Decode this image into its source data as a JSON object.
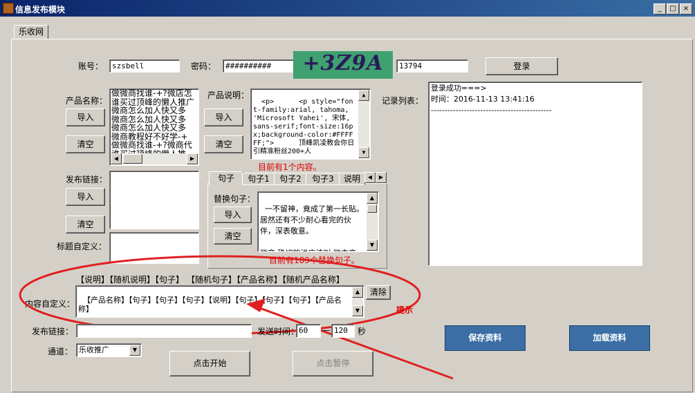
{
  "window": {
    "title": "信息发布模块",
    "minimize": "_",
    "maximize": "□",
    "close": "×"
  },
  "tab_main": "乐收网",
  "login": {
    "account_label": "账号：",
    "account_value": "szsbell",
    "password_label": "密码：",
    "password_value": "##########",
    "captcha_text": "+3Z9A",
    "captcha_input": "13794",
    "login_button": "登录"
  },
  "product_name": {
    "label": "产品名称：",
    "items": [
      "做微商找谁-+?微店怎",
      "谁买过顶峰的懒人推广",
      "微商怎么加人快又多",
      "微商怎么加人快又多",
      "微商怎么加人快又多",
      "微商教程好不好学-+",
      "做微商找谁-+?微商代",
      "谁买过顶峰的懒人推"
    ],
    "import": "导入",
    "clear": "清空"
  },
  "product_desc": {
    "label": "产品说明：",
    "text": "<p>      <p style=\"font-family:arial, tahoma, 'Microsoft Yahei', 宋体, sans-serif;font-size:16px;background-color:#FFFFFF;\">      顶峰凯凌教会你日引精准粉丝200+人",
    "import": "导入",
    "clear": "清空",
    "count": "目前有1个内容。"
  },
  "records": {
    "label": "记录列表：",
    "lines": [
      "登录成功===>",
      "时间：2016-11-13 13:41:16",
      "--------------------------------------------"
    ]
  },
  "publish_links": {
    "label": "发布链接：",
    "import": "导入",
    "clear": "清空"
  },
  "title_custom": {
    "label": "标题自定义："
  },
  "sentence_tabs": [
    "句子",
    "句子1",
    "句子2",
    "句子3",
    "说明"
  ],
  "replace_sentence": {
    "label": "替换句子：",
    "import": "导入",
    "clear": "清空",
    "text": "一不留神，竟成了第一长贴。居然还有不少耐心看完的伙伴，深表敬意。\n\n微商 确切的说应该叫 微电商",
    "count": "目前有189个替换句子。"
  },
  "tags": "【说明】【随机说明】【句子】 【随机句子】【产品名称】【随机产品名称】",
  "content_custom": {
    "label": "内容自定义：",
    "text": "【产品名称】【句子】【句子】【句子】【说明】【句子】【句子】【句子】【产品名称】",
    "clear": "清除"
  },
  "annotation": "提示",
  "bottom": {
    "link_label": "发布链接：",
    "send_time_label": "发送时间：",
    "time_from": "60",
    "dash": "—",
    "time_to": "120",
    "sec": "秒",
    "channel_label": "通道：",
    "channel_value": "乐收推广",
    "start": "点击开始",
    "pause": "点击暂停",
    "save": "保存资料",
    "load": "加载资料"
  },
  "colors": {
    "title_bar": "#0a246a",
    "accent_blue": "#3a6ea5",
    "annotation_red": "#e02020"
  },
  "icons": {
    "scroll_up": "▲",
    "scroll_down": "▼",
    "scroll_left": "◀",
    "scroll_right": "▶",
    "dropdown": "▼"
  }
}
